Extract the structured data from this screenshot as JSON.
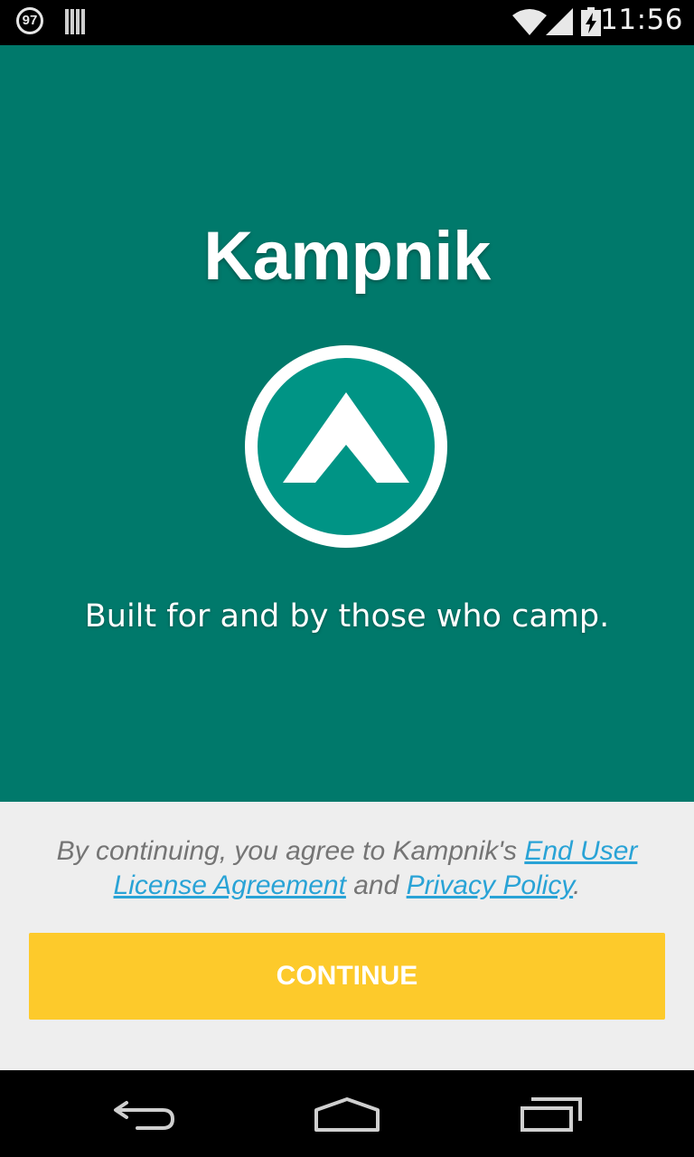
{
  "status_bar": {
    "badge": "97",
    "time": "11:56",
    "icons": [
      "notification-badge-icon",
      "barcode-icon",
      "wifi-icon",
      "signal-icon",
      "battery-charging-icon"
    ]
  },
  "hero": {
    "title": "Kampnik",
    "tagline": "Built for and by those who camp.",
    "background_color": "#00796b",
    "logo_icon": "tent-logo-icon"
  },
  "legal": {
    "prefix": "By continuing, you agree to Kampnik's ",
    "eula_link": "End User License Agreement",
    "middle": " and ",
    "privacy_link": "Privacy Policy",
    "suffix": ".",
    "link_color": "#29a3d6"
  },
  "continue_button": {
    "label": "CONTINUE",
    "color": "#fdca2b"
  },
  "nav_bar": {
    "icons": [
      "back-icon",
      "home-icon",
      "recents-icon"
    ]
  }
}
